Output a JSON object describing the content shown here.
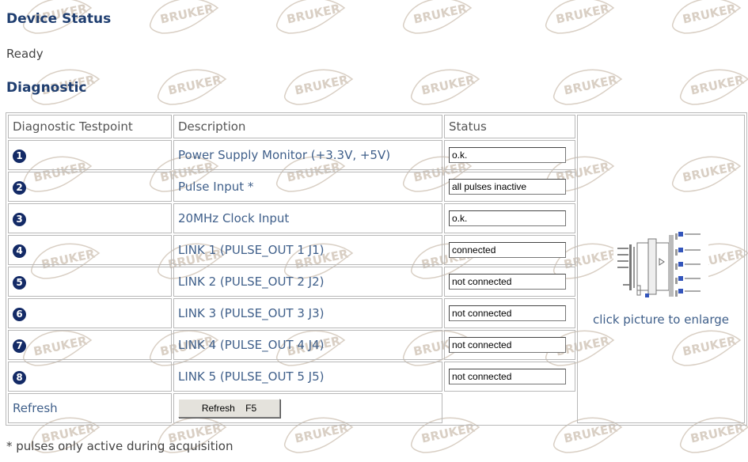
{
  "sections": {
    "device_status_title": "Device Status",
    "device_status_value": "Ready",
    "diagnostic_title": "Diagnostic"
  },
  "table": {
    "headers": [
      "Diagnostic Testpoint",
      "Description",
      "Status"
    ],
    "rows": [
      {
        "num": "1",
        "description": "Power Supply Monitor (+3.3V, +5V)",
        "status": "o.k."
      },
      {
        "num": "2",
        "description": "Pulse Input *",
        "status": "all pulses inactive"
      },
      {
        "num": "3",
        "description": "20MHz Clock Input",
        "status": "o.k."
      },
      {
        "num": "4",
        "description": "LINK 1 (PULSE_OUT 1 J1)",
        "status": "connected"
      },
      {
        "num": "5",
        "description": "LINK 2 (PULSE_OUT 2 J2)",
        "status": "not connected"
      },
      {
        "num": "6",
        "description": "LINK 3 (PULSE_OUT 3 J3)",
        "status": "not connected"
      },
      {
        "num": "7",
        "description": "LINK 4 (PULSE_OUT 4 J4)",
        "status": "not connected"
      },
      {
        "num": "8",
        "description": "LINK 5 (PULSE_OUT 5 J5)",
        "status": "not connected"
      }
    ],
    "refresh_label": "Refresh",
    "refresh_button": "Refresh    F5"
  },
  "picture": {
    "caption": "click picture to enlarge"
  },
  "footnote": "* pulses only active during acquisition",
  "watermark": {
    "text": "BRUKER",
    "color": "#d9cfc4"
  },
  "colors": {
    "heading": "#1f3e70",
    "link_text": "#3f5f8a",
    "badge": "#132a66"
  }
}
